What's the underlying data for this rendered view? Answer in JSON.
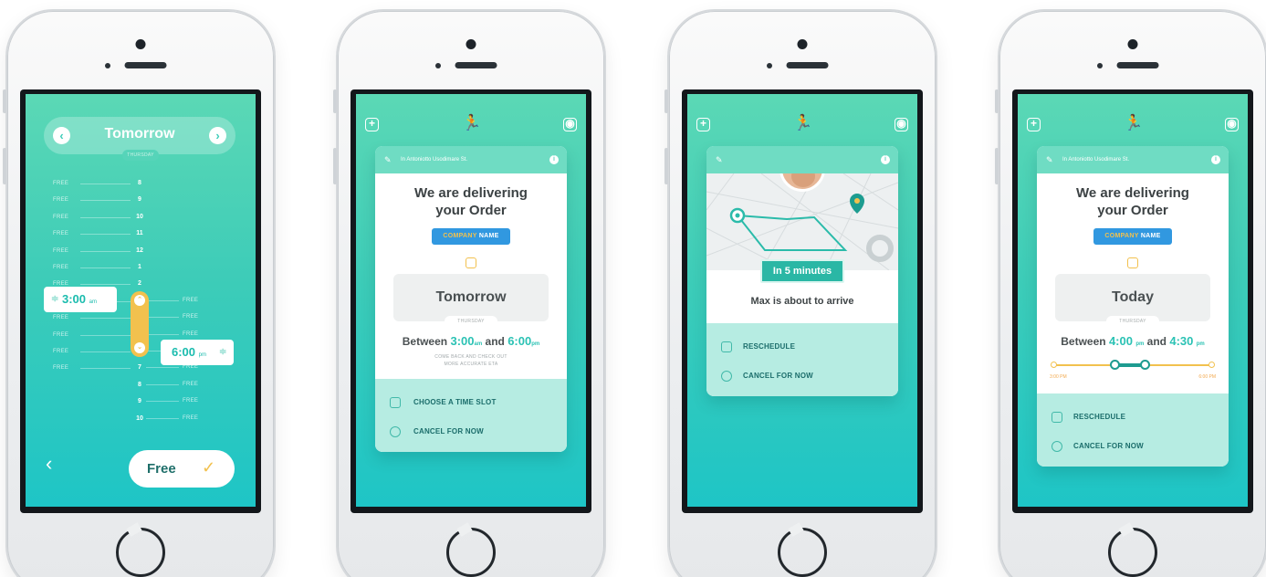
{
  "screen1": {
    "day": "Tomorrow",
    "weekday": "THURSDAY",
    "prev_icon": "chevron-left-icon",
    "next_icon": "chevron-right-icon",
    "free_label": "FREE",
    "hours": [
      "8",
      "9",
      "10",
      "11",
      "12",
      "1",
      "2",
      "3",
      "4",
      "5",
      "6",
      "7",
      "8",
      "9",
      "10"
    ],
    "start_time": "3:00",
    "start_suffix": "am",
    "end_time": "6:00",
    "end_suffix": "pm",
    "confirm_label": "Free"
  },
  "screen2": {
    "address": "In Antoniotto Usodimare St.",
    "title_line1": "We are delivering",
    "title_line2": "your Order",
    "company_a": "COMPANY",
    "company_b": "NAME",
    "day": "Tomorrow",
    "weekday": "THURSDAY",
    "between": "Between",
    "and": "and",
    "from": "3:00",
    "from_suffix": "am",
    "to": "6:00",
    "to_suffix": "pm",
    "note_line1": "COME BACK AND CHECK OUT",
    "note_line2": "MORE ACCURATE ETA",
    "action1": "CHOOSE A TIME SLOT",
    "action2": "CANCEL FOR NOW"
  },
  "screen3": {
    "eta": "In 5 minutes",
    "arrive": "Max is about to arrive",
    "action1": "RESCHEDULE",
    "action2": "CANCEL FOR NOW"
  },
  "screen4": {
    "address": "In Antoniotto Usodimare St.",
    "title_line1": "We are delivering",
    "title_line2": "your Order",
    "company_a": "COMPANY",
    "company_b": "NAME",
    "day": "Today",
    "weekday": "THURSDAY",
    "between": "Between",
    "and": "and",
    "from": "4:00",
    "from_suffix": "pm",
    "to": "4:30",
    "to_suffix": "pm",
    "range_start": "3:00 PM",
    "range_end": "6:00 PM",
    "action1": "RESCHEDULE",
    "action2": "CANCEL FOR NOW"
  },
  "colors": {
    "teal": "#3dccb8",
    "accent_yellow": "#f2c14e",
    "company_blue": "#3198e0"
  }
}
